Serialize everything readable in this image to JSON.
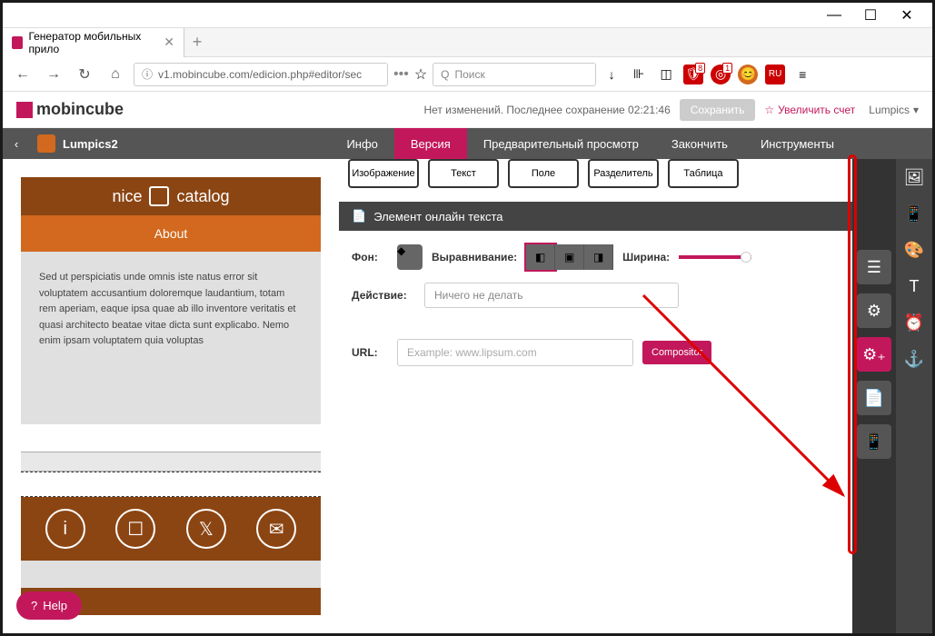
{
  "window": {
    "title": "Генератор мобильных прило"
  },
  "browser": {
    "url": "v1.mobincube.com/edicion.php#editor/sec",
    "search_placeholder": "Поиск"
  },
  "toolbar_badges": {
    "shield": "8",
    "ring": "1"
  },
  "header": {
    "logo": "mobincube",
    "status": "Нет изменений. Последнее сохранение 02:21:46",
    "save": "Сохранить",
    "upgrade": "Увеличить счет",
    "user": "Lumpics"
  },
  "nav": {
    "app_name": "Lumpics2",
    "tabs": {
      "info": "Инфо",
      "version": "Версия",
      "preview": "Предварительный просмотр",
      "finish": "Закончить",
      "tools": "Инструменты"
    }
  },
  "mock": {
    "title_left": "nice",
    "title_right": "catalog",
    "about": "About",
    "body": "Sed ut perspiciatis unde omnis iste natus error sit voluptatem accusantium doloremque laudantium, totam rem aperiam, eaque ipsa quae ab illo inventore veritatis et quasi architecto beatae vitae dicta sunt explicabo. Nemo enim ipsam voluptatem quia voluptas"
  },
  "elements": {
    "image": "Изображение",
    "text": "Текст",
    "field": "Поле",
    "divider": "Разделитель",
    "table": "Таблица"
  },
  "section": {
    "title": "Элемент онлайн текста"
  },
  "props": {
    "bg_label": "Фон:",
    "align_label": "Выравнивание:",
    "width_label": "Ширина:",
    "width_value": "100%",
    "action_label": "Действие:",
    "action_value": "Ничего не делать",
    "url_label": "URL:",
    "url_placeholder": "Example: www.lipsum.com",
    "compositor": "Compositor",
    "default": "С"
  },
  "help": {
    "label": "Help"
  }
}
